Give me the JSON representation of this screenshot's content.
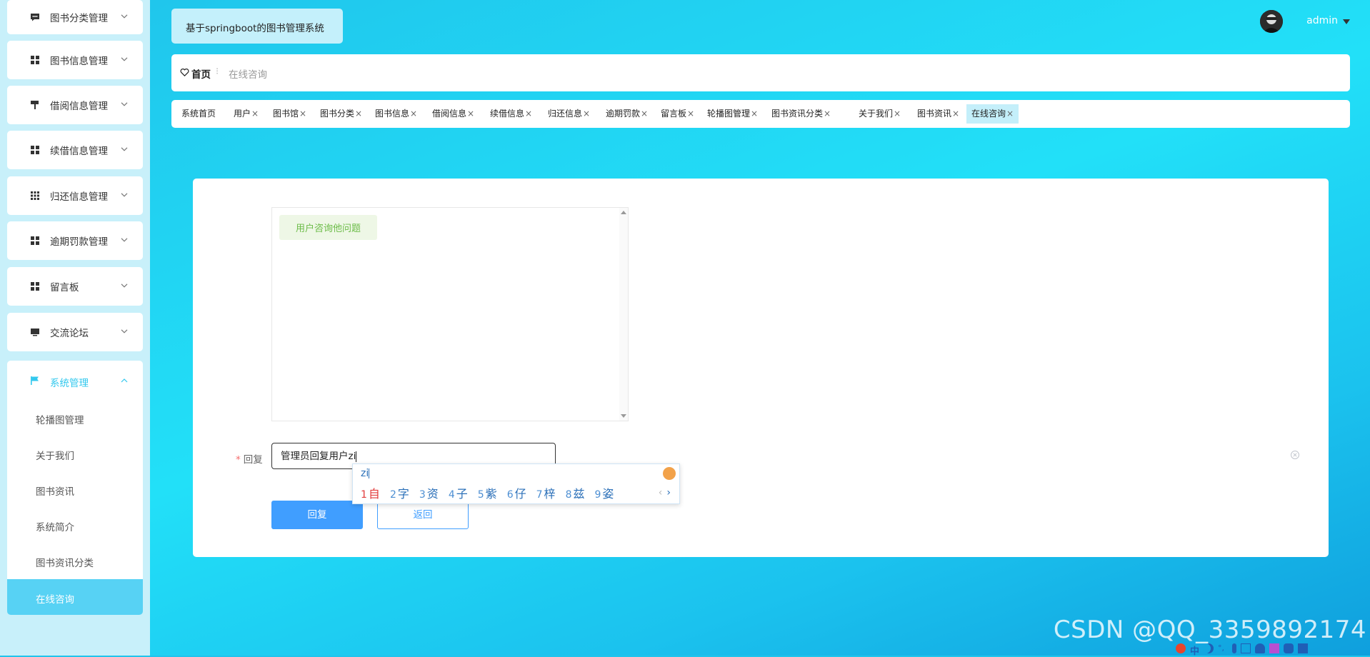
{
  "sidebar": {
    "groups": [
      {
        "label": "图书分类管理",
        "icon": "chat-icon"
      },
      {
        "label": "图书信息管理",
        "icon": "grid-icon"
      },
      {
        "label": "借阅信息管理",
        "icon": "paint-roller-icon"
      },
      {
        "label": "续借信息管理",
        "icon": "grid-icon"
      },
      {
        "label": "归还信息管理",
        "icon": "apps-icon"
      },
      {
        "label": "逾期罚款管理",
        "icon": "grid-icon"
      },
      {
        "label": "留言板",
        "icon": "grid-icon"
      },
      {
        "label": "交流论坛",
        "icon": "monitor-icon"
      }
    ],
    "expanded": {
      "label": "系统管理",
      "icon": "flag-icon",
      "items": [
        "轮播图管理",
        "关于我们",
        "图书资讯",
        "系统简介",
        "图书资讯分类",
        "在线咨询"
      ]
    }
  },
  "header": {
    "system_title": "基于springboot的图书管理系统",
    "user_name": "admin"
  },
  "breadcrumb": {
    "home": "首页",
    "separator": "⁝",
    "current": "在线咨询"
  },
  "tags": [
    {
      "label": "系统首页",
      "closable": false
    },
    {
      "label": "用户",
      "closable": true
    },
    {
      "label": "图书馆",
      "closable": true
    },
    {
      "label": "图书分类",
      "closable": true
    },
    {
      "label": "图书信息",
      "closable": true
    },
    {
      "label": "借阅信息",
      "closable": true
    },
    {
      "label": "续借信息",
      "closable": true
    },
    {
      "label": "归还信息",
      "closable": true
    },
    {
      "label": "逾期罚款",
      "closable": true
    },
    {
      "label": "留言板",
      "closable": true
    },
    {
      "label": "轮播图管理",
      "closable": true
    },
    {
      "label": "图书资讯分类",
      "closable": true
    },
    {
      "label": "关于我们",
      "closable": true
    },
    {
      "label": "图书资讯",
      "closable": true
    },
    {
      "label": "在线咨询",
      "closable": true,
      "active": true
    }
  ],
  "tag_close": "×",
  "chat": {
    "messages": [
      "用户咨询他问题"
    ]
  },
  "reply": {
    "required_mark": "*",
    "label": "回复",
    "value": "管理员回复用户zi"
  },
  "buttons": {
    "reply": "回复",
    "back": "返回"
  },
  "ime": {
    "composition": "zi",
    "candidates": [
      {
        "num": "1",
        "char": "自"
      },
      {
        "num": "2",
        "char": "字"
      },
      {
        "num": "3",
        "char": "资"
      },
      {
        "num": "4",
        "char": "子"
      },
      {
        "num": "5",
        "char": "紫"
      },
      {
        "num": "6",
        "char": "仔"
      },
      {
        "num": "7",
        "char": "梓"
      },
      {
        "num": "8",
        "char": "兹"
      },
      {
        "num": "9",
        "char": "姿"
      }
    ],
    "prev": "‹",
    "next": "›"
  },
  "watermark": "CSDN @QQ_3359892174",
  "tray": {
    "lang": "中"
  },
  "colors": {
    "accent": "#32c8ee",
    "primary_button": "#409eff",
    "background": "#20c4ec"
  }
}
